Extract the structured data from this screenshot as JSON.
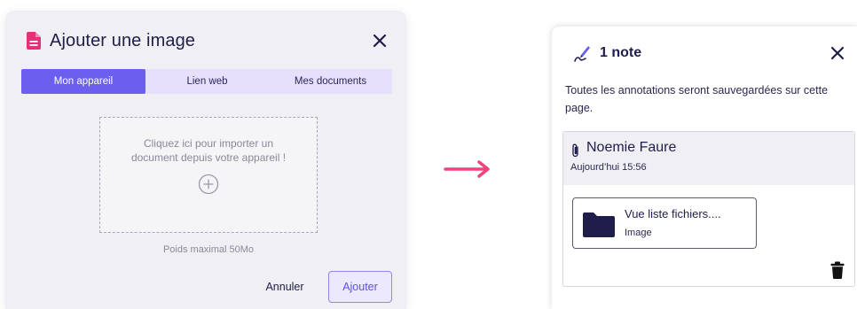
{
  "upload_dialog": {
    "title": "Ajouter une image",
    "close_icon": "close-icon",
    "tabs": [
      {
        "label": "Mon appareil",
        "active": true
      },
      {
        "label": "Lien web",
        "active": false
      },
      {
        "label": "Mes documents",
        "active": false
      }
    ],
    "dropzone_text": "Cliquez ici pour importer un document depuis votre appareil !",
    "max_weight": "Poids maximal 50Mo",
    "cancel_label": "Annuler",
    "submit_label": "Ajouter"
  },
  "note_panel": {
    "title": "1 note",
    "description": "Toutes les annotations seront sauvegardées sur cette page.",
    "note": {
      "author": "Noemie Faure",
      "time": "Aujourd’hui 15:56",
      "attachment": {
        "name": "Vue liste fichiers....",
        "type": "Image"
      }
    }
  },
  "colors": {
    "accent": "#6c5ff0",
    "doc_icon": "#e8307a",
    "arrow": "#f0447e",
    "navy": "#1f1d4a"
  }
}
